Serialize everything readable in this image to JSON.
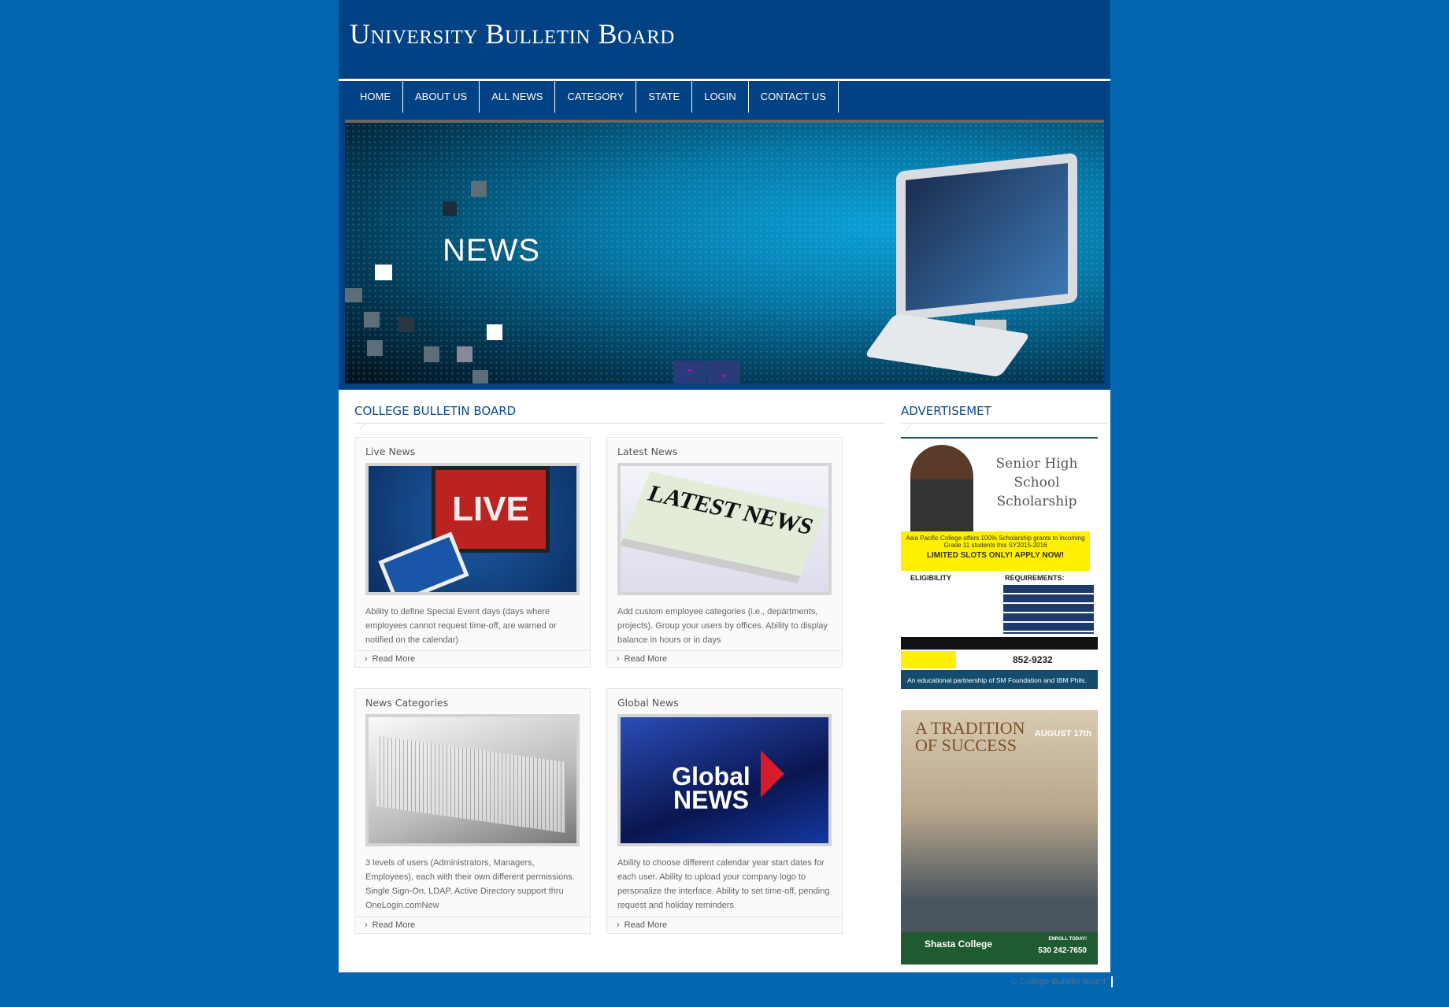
{
  "header": {
    "title": "University Bulletin Board"
  },
  "nav": [
    "HOME",
    "ABOUT US",
    "ALL NEWS",
    "CATEGORY",
    "STATE",
    "LOGIN",
    "CONTACT US"
  ],
  "banner": {
    "title": "NEWS",
    "prev_icon": "chevron-up-icon",
    "next_icon": "chevron-down-icon"
  },
  "main": {
    "title": "COLLEGE BULLETIN BOARD",
    "read_more": "Read More",
    "cards": [
      {
        "title": "Live News",
        "text": "Ability to define Special Event days (days where employees cannot request time-off, are warned or notified on the calendar)",
        "image_text": "LIVE"
      },
      {
        "title": "Latest News",
        "text": "Add custom employee categories (i.e., departments, projects). Group your users by offices. Ability to display balance in hours or in days",
        "image_text": "LATEST NEWS"
      },
      {
        "title": "News Categories",
        "text": "3 levels of users (Administrators, Managers, Employees), each with their own different permissions. Single Sign-On, LDAP, Active Directory support thru OneLogin.comNew",
        "image_text": ""
      },
      {
        "title": "Global News",
        "text": "Ability to choose different calendar year start dates for each user. Ability to upload your company logo to personalize the interface. Ability to set time-off, pending request and holiday reminders",
        "image_text": "Global NEWS"
      }
    ]
  },
  "sidebar": {
    "title": "ADVERTISEMET",
    "ad1": {
      "heading": "Senior High School Scholarship",
      "offer": "Asia Pacific College offers 100% Scholarship grants to incoming Grade 11 students this SY2015-2016",
      "cta": "LIMITED SLOTS ONLY! APPLY NOW!",
      "eligibility": "ELIGIBILITY",
      "requirements": "REQUIREMENTS:",
      "phone": "852-9232",
      "partner": "An educational partnership of SM Foundation and IBM Phils."
    },
    "ad2": {
      "heading": "A TRADITION OF SUCCESS",
      "date": "AUGUST 17th",
      "school": "Shasta College",
      "enroll": "ENROLL TODAY!",
      "phone": "530 242-7650"
    }
  },
  "footer": {
    "text": "© College Bulletin Board"
  },
  "colors": {
    "background": "#0266b2",
    "header": "#004283",
    "heading": "#0a4a8c"
  }
}
